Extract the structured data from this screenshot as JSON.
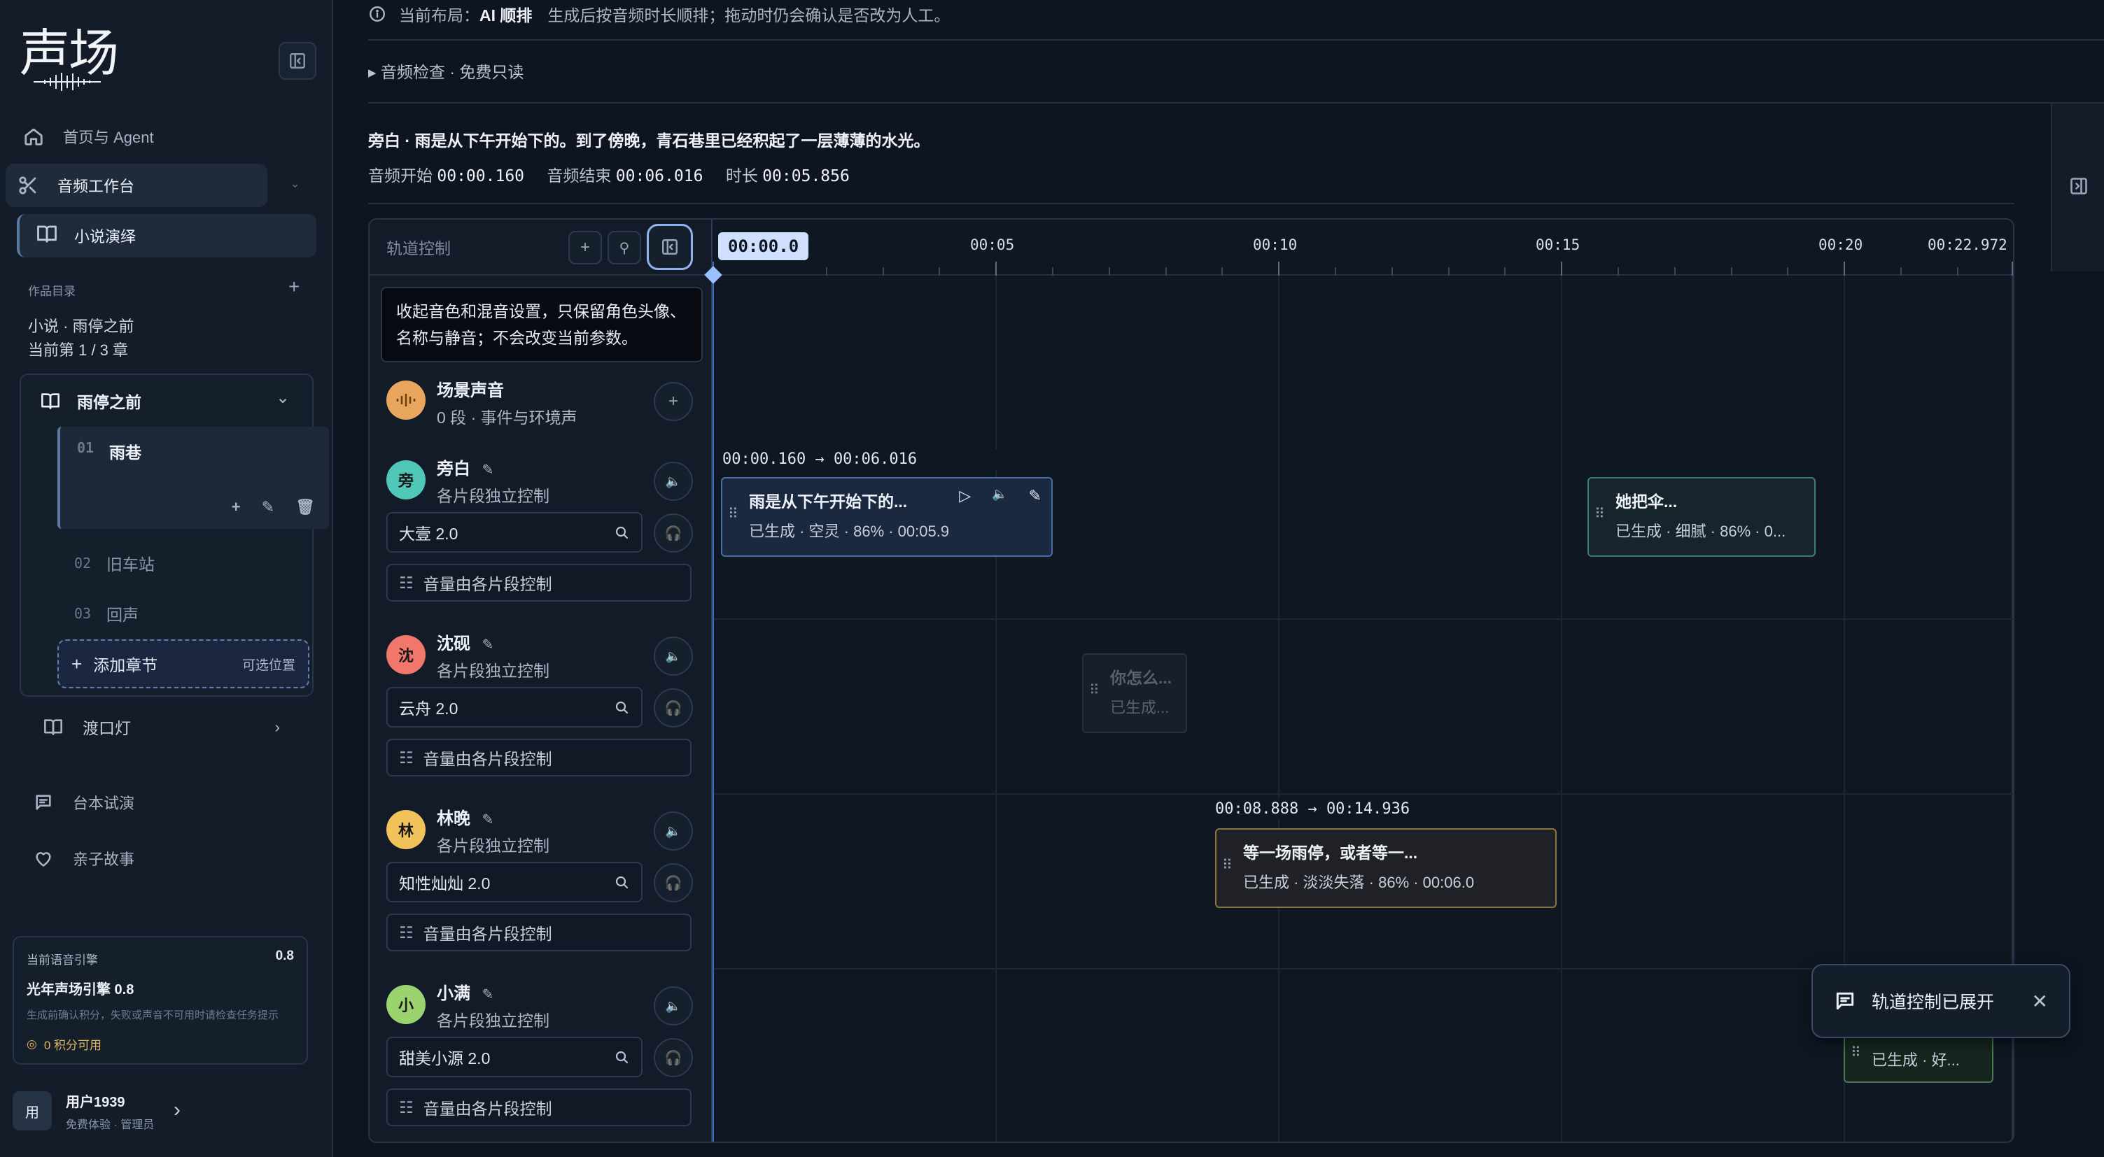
{
  "brand": {
    "logo_text": "声场"
  },
  "nav": {
    "home": "首页与 Agent",
    "workbench": "音频工作台",
    "novel": "小说演绎",
    "script_trial": "台本试演",
    "kids_story": "亲子故事"
  },
  "works": {
    "section_label": "作品目录",
    "title": "小说 · 雨停之前",
    "progress": "当前第 1 / 3 章",
    "book1": {
      "title": "雨停之前"
    },
    "chapters": [
      {
        "num": "01",
        "title": "雨巷"
      },
      {
        "num": "02",
        "title": "旧车站"
      },
      {
        "num": "03",
        "title": "回声"
      }
    ],
    "add_chapter": "添加章节",
    "add_chapter_opt": "可选位置",
    "book2": {
      "title": "渡口灯"
    }
  },
  "engine": {
    "label": "当前语音引擎",
    "version": "0.8",
    "name": "光年声场引擎 0.8",
    "note": "生成前确认积分，失败或声音不可用时请检查任务提示",
    "credits": "0 积分可用"
  },
  "user": {
    "avatar": "用",
    "name": "用户1939",
    "role": "免费体验 · 管理员"
  },
  "banner": {
    "prefix": "当前布局：",
    "mode": "AI 顺排",
    "text": "生成后按音频时长顺排；拖动时仍会确认是否改为人工。"
  },
  "audio_check": "▸ 音频检查 · 免费只读",
  "sentence": "旁白 · 雨是从下午开始下的。到了傍晚，青石巷里已经积起了一层薄薄的水光。",
  "times": {
    "start_label": "音频开始",
    "start": "00:00.160",
    "end_label": "音频结束",
    "end": "00:06.016",
    "dur_label": "时长",
    "dur": "00:05.856"
  },
  "track_panel": {
    "title": "轨道控制",
    "tooltip": "收起音色和混音设置，只保留角色头像、名称与静音；不会改变当前参数。"
  },
  "tracks": [
    {
      "avatar": "",
      "name": "场景声音",
      "sub": "0 段 · 事件与环境声",
      "color": "#e8a65c"
    },
    {
      "avatar": "旁",
      "name": "旁白",
      "sub": "各片段独立控制",
      "voice": "大壹 2.0",
      "vol": "音量由各片段控制",
      "color": "#4fc8b8"
    },
    {
      "avatar": "沈",
      "name": "沈砚",
      "sub": "各片段独立控制",
      "voice": "云舟 2.0",
      "vol": "音量由各片段控制",
      "color": "#f0776a"
    },
    {
      "avatar": "林",
      "name": "林晚",
      "sub": "各片段独立控制",
      "voice": "知性灿灿 2.0",
      "vol": "音量由各片段控制",
      "color": "#f2c25a"
    },
    {
      "avatar": "小",
      "name": "小满",
      "sub": "各片段独立控制",
      "voice": "甜美小源 2.0",
      "vol": "音量由各片段控制",
      "color": "#9bd46e"
    }
  ],
  "ruler": {
    "playhead": "00:00.0",
    "ticks": [
      "00:05",
      "00:10",
      "00:15",
      "00:20"
    ],
    "end": "00:22.972"
  },
  "clips": {
    "narr_range": "00:00.160 → 00:06.016",
    "narr1_title": "雨是从下午开始下的...",
    "narr1_meta": "已生成 · 空灵 · 86% · 00:05.9",
    "narr2_title": "她把伞...",
    "narr2_meta": "已生成 · 细腻 · 86% · 0...",
    "shen_title": "你怎么...",
    "shen_meta": "已生成...",
    "lin_range": "00:08.888 → 00:14.936",
    "lin_title": "等一场雨停，或者等一...",
    "lin_meta": "已生成 · 淡淡失落 · 86% · 00:06.0",
    "xm_meta": "已生成 · 好..."
  },
  "toast": {
    "text": "轨道控制已展开"
  }
}
